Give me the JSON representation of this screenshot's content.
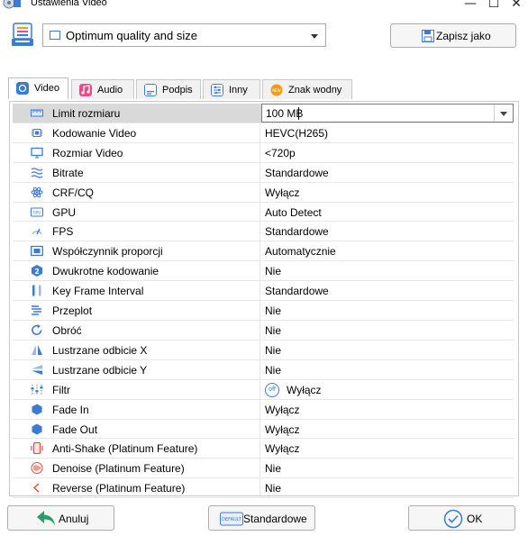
{
  "window": {
    "title": "Ustawienia Video",
    "minimize_glyph": "—",
    "maximize_glyph": "☐",
    "close_glyph": "✕"
  },
  "preset": {
    "selected": "Optimum quality and size",
    "icon": "film-icon"
  },
  "save_as_label": "Zapisz jako",
  "tabs": [
    {
      "label": "Video",
      "icon": "video-icon",
      "color": "#3a7bd5",
      "active": true
    },
    {
      "label": "Audio",
      "icon": "music-note-icon",
      "color": "#e84a8a"
    },
    {
      "label": "Podpis",
      "icon": "subtitle-icon",
      "color": "#3a7bd5"
    },
    {
      "label": "Inny",
      "icon": "sliders-icon",
      "color": "#3a7bd5"
    },
    {
      "label": "Znak wodny",
      "icon": "new-badge-icon",
      "color": "#f39c12"
    }
  ],
  "properties": [
    {
      "label": "Limit rozmiaru",
      "value": "100 MB",
      "icon": "ruler-icon"
    },
    {
      "label": "Kodowanie Video",
      "value": "HEVC(H265)",
      "icon": "chip-icon"
    },
    {
      "label": "Rozmiar Video",
      "value": "<720p",
      "icon": "monitor-icon"
    },
    {
      "label": "Bitrate",
      "value": "Standardowe",
      "icon": "waves-icon"
    },
    {
      "label": "CRF/CQ",
      "value": "Wyłącz",
      "icon": "atom-icon"
    },
    {
      "label": "GPU",
      "value": "Auto Detect",
      "icon": "gpu-icon",
      "icon_text": "GPU"
    },
    {
      "label": "FPS",
      "value": "Standardowe",
      "icon": "speedometer-icon"
    },
    {
      "label": "Współczynnik proporcji",
      "value": "Automatycznie",
      "icon": "aspect-ratio-icon"
    },
    {
      "label": "Dwukrotne kodowanie",
      "value": "Nie",
      "icon": "two-pass-icon",
      "icon_text": "2"
    },
    {
      "label": "Key Frame Interval",
      "value": "Standardowe",
      "icon": "keyframe-icon"
    },
    {
      "label": "Przeplot",
      "value": "Nie",
      "icon": "interlace-icon"
    },
    {
      "label": "Obróć",
      "value": "Nie",
      "icon": "rotate-icon"
    },
    {
      "label": "Lustrzane odbicie X",
      "value": "Nie",
      "icon": "mirror-x-icon"
    },
    {
      "label": "Lustrzane odbicie Y",
      "value": "Nie",
      "icon": "mirror-y-icon"
    },
    {
      "label": "Filtr",
      "value": "Wyłącz",
      "icon": "filter-icon",
      "badge": "off"
    },
    {
      "label": "Fade In",
      "value": "Wyłącz",
      "icon": "hexagon-icon"
    },
    {
      "label": "Fade Out",
      "value": "Wyłącz",
      "icon": "hexagon-icon"
    },
    {
      "label": "Anti-Shake (Platinum Feature)",
      "value": "Wyłącz",
      "icon": "phone-shake-icon"
    },
    {
      "label": "Denoise (Platinum Feature)",
      "value": "Nie",
      "icon": "denoise-icon"
    },
    {
      "label": "Reverse (Platinum Feature)",
      "value": "Nie",
      "icon": "reverse-icon"
    }
  ],
  "buttons": {
    "cancel": "Anuluj",
    "default": "Standardowe",
    "default_icon_text": "DEFAULT",
    "ok": "OK"
  },
  "colors": {
    "accent": "#3a7bd5",
    "selected_row": "#d9d9d9",
    "cancel_arrow": "#2e9a6b"
  }
}
